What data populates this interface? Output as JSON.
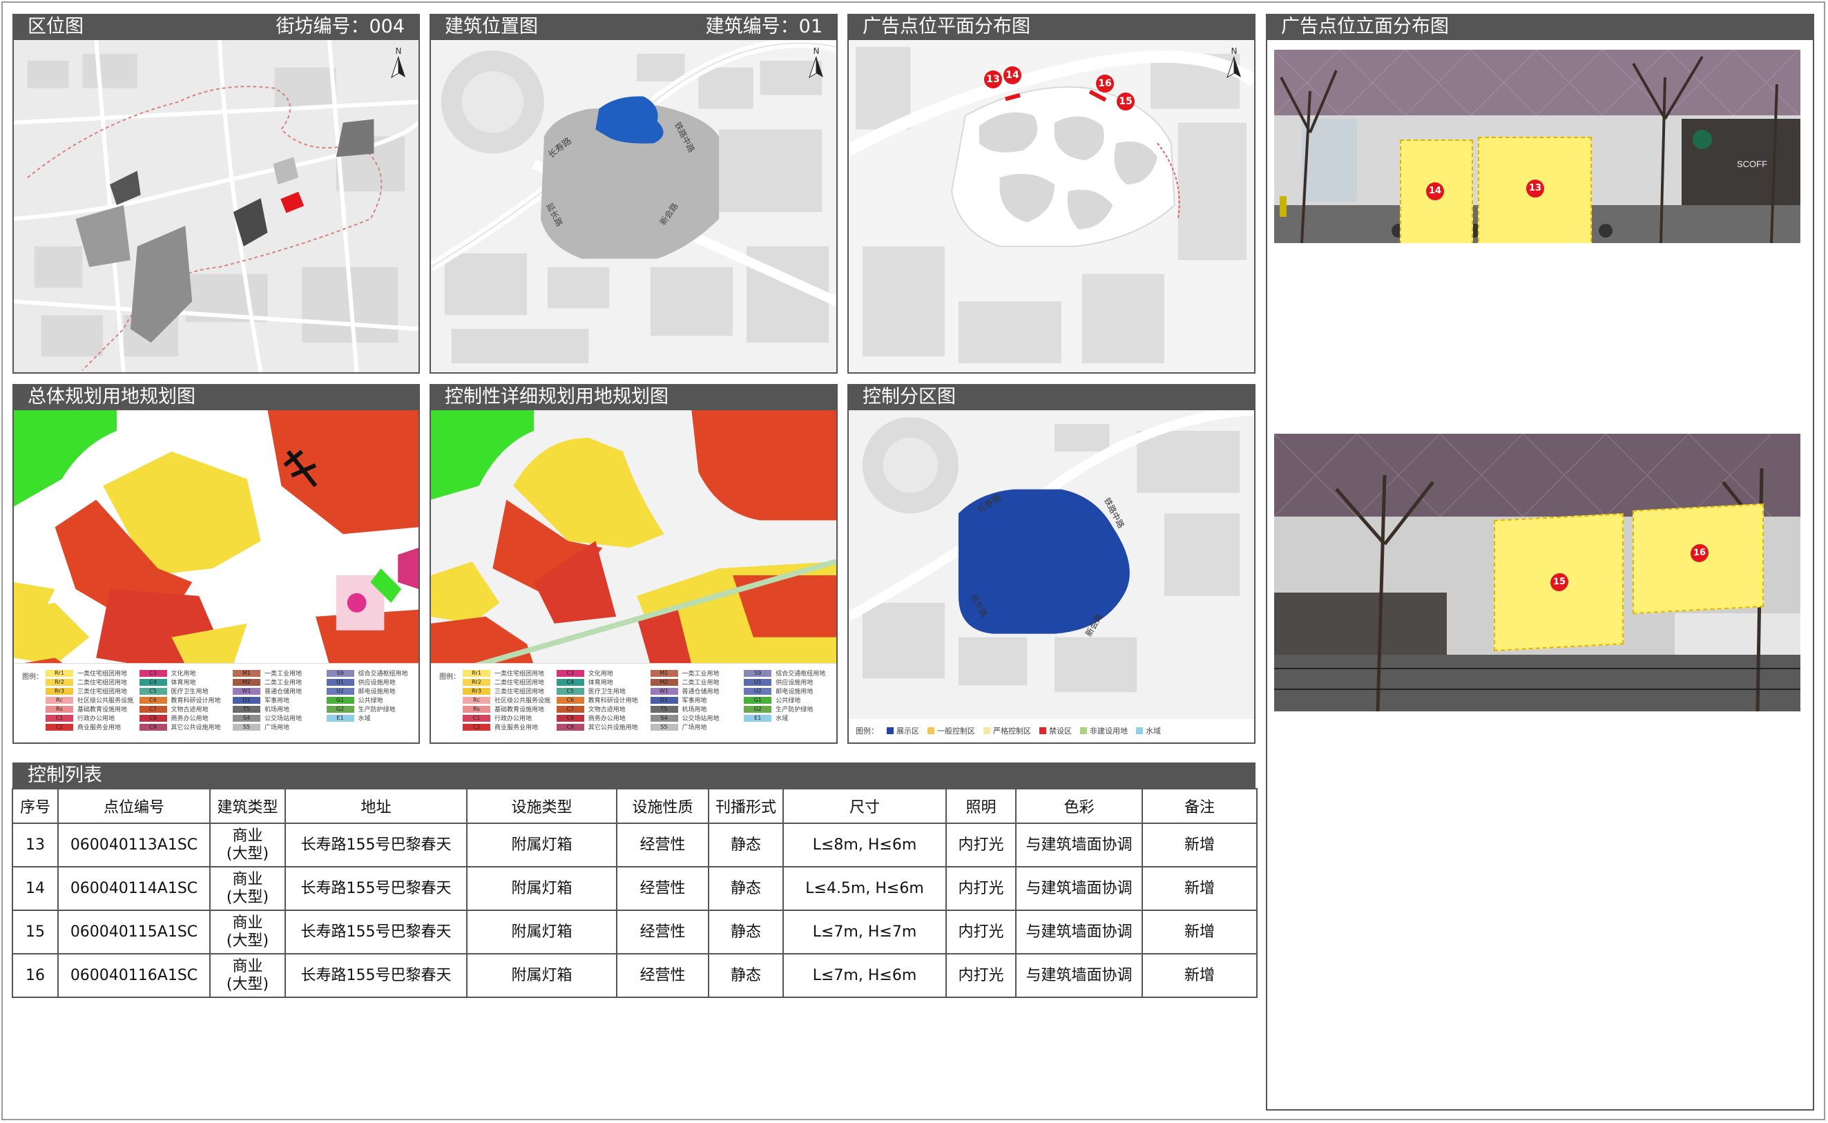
{
  "panels": {
    "location": {
      "title": "区位图",
      "right_label": "街坊编号：004"
    },
    "building": {
      "title": "建筑位置图",
      "right_label": "建筑编号：01"
    },
    "ad_plan": {
      "title": "广告点位平面分布图"
    },
    "ad_elevation": {
      "title": "广告点位立面分布图"
    },
    "master_plan": {
      "title": "总体规划用地规划图"
    },
    "detail_plan": {
      "title": "控制性详细规划用地规划图"
    },
    "zoning": {
      "title": "控制分区图"
    },
    "control_list": {
      "title": "控制列表"
    }
  },
  "map_labels": {
    "north": "N",
    "changshou_road": "长寿路",
    "tiequ_road": "铁路中路",
    "yanchang_road": "延长路",
    "xinhui_road": "新会路"
  },
  "ad_points": [
    {
      "id": "13",
      "color": "#e3141b"
    },
    {
      "id": "14",
      "color": "#e3141b"
    },
    {
      "id": "15",
      "color": "#e3141b"
    },
    {
      "id": "16",
      "color": "#e3141b"
    }
  ],
  "elevation_photos": {
    "photo1": {
      "sign_text": "SCOFF",
      "boards": [
        "14",
        "13"
      ]
    },
    "photo2": {
      "boards": [
        "15",
        "16"
      ]
    }
  },
  "land_use_legend": {
    "title": "图例：",
    "items": [
      {
        "code": "Rr1",
        "label": "一类住宅组团用地",
        "color": "#fbe56a"
      },
      {
        "code": "C3",
        "label": "文化用地",
        "color": "#d6347a"
      },
      {
        "code": "M1",
        "label": "一类工业用地",
        "color": "#b86a55"
      },
      {
        "code": "S9",
        "label": "综合交通枢纽用地",
        "color": "#8b86b8"
      },
      {
        "code": "Rr2",
        "label": "二类住宅组团用地",
        "color": "#f7d44a"
      },
      {
        "code": "C4",
        "label": "体育用地",
        "color": "#2e9b8c"
      },
      {
        "code": "M2",
        "label": "二类工业用地",
        "color": "#a45842"
      },
      {
        "code": "U1",
        "label": "供应设施用地",
        "color": "#5a6bb0"
      },
      {
        "code": "Rr3",
        "label": "三类住宅组团用地",
        "color": "#f3c73a"
      },
      {
        "code": "C5",
        "label": "医疗卫生用地",
        "color": "#55aa99"
      },
      {
        "code": "W1",
        "label": "普通仓储用地",
        "color": "#9a79b8"
      },
      {
        "code": "U2",
        "label": "邮电设施用地",
        "color": "#6878b8"
      },
      {
        "code": "Rc",
        "label": "社区级公共服务设施用地",
        "color": "#f2a6a6"
      },
      {
        "code": "C6",
        "label": "教育科研设计用地",
        "color": "#e07a2e"
      },
      {
        "code": "D1",
        "label": "军事用地",
        "color": "#4a5da8"
      },
      {
        "code": "G1",
        "label": "公共绿地",
        "color": "#49b13a"
      },
      {
        "code": "Rs",
        "label": "基础教育设施用地",
        "color": "#e98f8f"
      },
      {
        "code": "C7",
        "label": "文物古迹用地",
        "color": "#c3562c"
      },
      {
        "code": "T5",
        "label": "机场用地",
        "color": "#6a6a6a"
      },
      {
        "code": "G2",
        "label": "生产防护绿地",
        "color": "#67a94b"
      },
      {
        "code": "C1",
        "label": "行政办公用地",
        "color": "#d9425f"
      },
      {
        "code": "C8",
        "label": "商务办公用地",
        "color": "#c32f3f"
      },
      {
        "code": "S4",
        "label": "公交场站用地",
        "color": "#8c8c8c"
      },
      {
        "code": "E1",
        "label": "水域",
        "color": "#8fd0e8"
      },
      {
        "code": "C2",
        "label": "商业服务业用地",
        "color": "#d43333"
      },
      {
        "code": "C9",
        "label": "其它公共设施用地",
        "color": "#b24b6b"
      },
      {
        "code": "S5",
        "label": "广场用地",
        "color": "#bdbdbd"
      }
    ]
  },
  "zoning_legend": {
    "title": "图例：",
    "items": [
      {
        "label": "展示区",
        "color": "#1f47a8"
      },
      {
        "label": "一般控制区",
        "color": "#f5c64e"
      },
      {
        "label": "严格控制区",
        "color": "#f7e7a0"
      },
      {
        "label": "禁设区",
        "color": "#e2262a"
      },
      {
        "label": "非建设用地",
        "color": "#a9d67d"
      },
      {
        "label": "水域",
        "color": "#8fd0e8"
      }
    ]
  },
  "control_table": {
    "headers": [
      "序号",
      "点位编号",
      "建筑类型",
      "地址",
      "设施类型",
      "设施性质",
      "刊播形式",
      "尺寸",
      "照明",
      "色彩",
      "备注"
    ],
    "rows": [
      {
        "no": "13",
        "code": "060040113A1SC",
        "type_a": "商业",
        "type_b": "(大型)",
        "address": "长寿路155号巴黎春天",
        "facility": "附属灯箱",
        "nature": "经营性",
        "form": "静态",
        "size": "L≤8m, H≤6m",
        "light": "内打光",
        "color": "与建筑墙面协调",
        "note": "新增"
      },
      {
        "no": "14",
        "code": "060040114A1SC",
        "type_a": "商业",
        "type_b": "(大型)",
        "address": "长寿路155号巴黎春天",
        "facility": "附属灯箱",
        "nature": "经营性",
        "form": "静态",
        "size": "L≤4.5m, H≤6m",
        "light": "内打光",
        "color": "与建筑墙面协调",
        "note": "新增"
      },
      {
        "no": "15",
        "code": "060040115A1SC",
        "type_a": "商业",
        "type_b": "(大型)",
        "address": "长寿路155号巴黎春天",
        "facility": "附属灯箱",
        "nature": "经营性",
        "form": "静态",
        "size": "L≤7m, H≤7m",
        "light": "内打光",
        "color": "与建筑墙面协调",
        "note": "新增"
      },
      {
        "no": "16",
        "code": "060040116A1SC",
        "type_a": "商业",
        "type_b": "(大型)",
        "address": "长寿路155号巴黎春天",
        "facility": "附属灯箱",
        "nature": "经营性",
        "form": "静态",
        "size": "L≤7m, H≤6m",
        "light": "内打光",
        "color": "与建筑墙面协调",
        "note": "新增"
      }
    ]
  }
}
